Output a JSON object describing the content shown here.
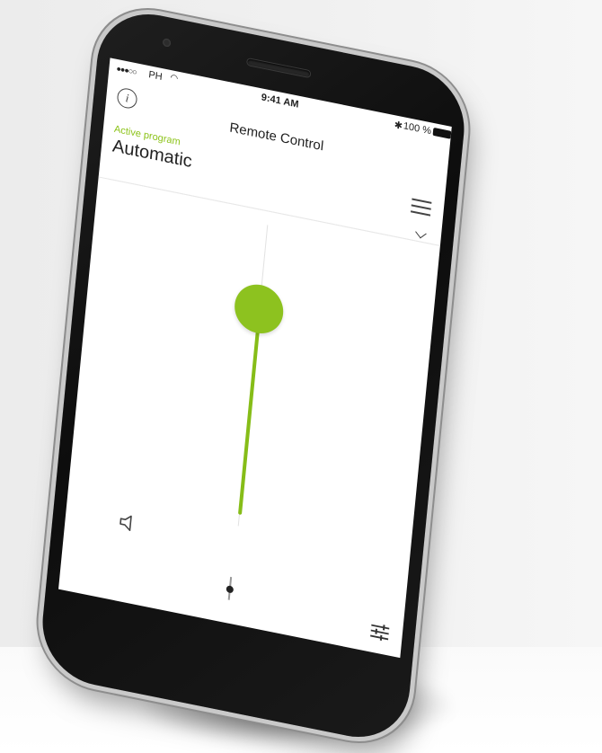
{
  "status_bar": {
    "signal": "●●●○○",
    "carrier": "PH",
    "wifi_icon": "wifi-icon",
    "time": "9:41 AM",
    "bluetooth_icon": "bluetooth-icon",
    "battery": "100 %"
  },
  "header": {
    "info_label": "i",
    "title": "Remote Control",
    "active_label": "Active program",
    "program": "Automatic"
  },
  "volume": {
    "level": 0.78
  },
  "colors": {
    "accent": "#8dc21f"
  }
}
